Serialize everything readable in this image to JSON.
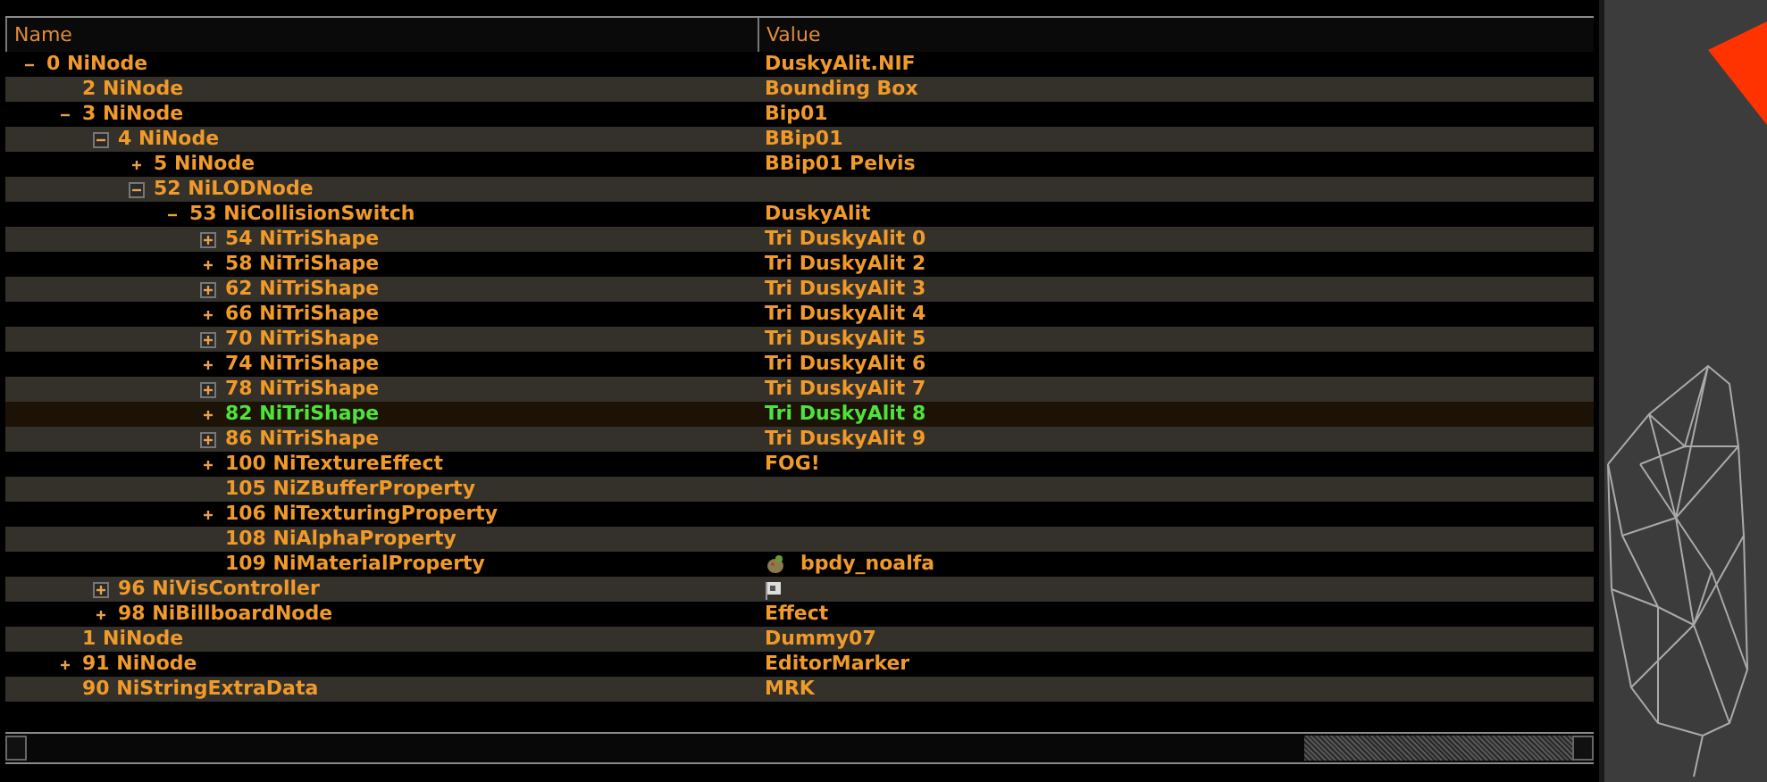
{
  "columns": [
    "Name",
    "Value"
  ],
  "tree": [
    {
      "name": "0 NiNode",
      "value": "DuskyAlit.NIF",
      "kind": "branch",
      "expanded": true,
      "boxed": false,
      "selected": false,
      "children": [
        {
          "name": "2 NiNode",
          "value": "Bounding Box",
          "kind": "leaf",
          "selected": false
        },
        {
          "name": "3 NiNode",
          "value": "Bip01",
          "kind": "branch",
          "expanded": true,
          "boxed": false,
          "selected": false,
          "children": [
            {
              "name": "4 NiNode",
              "value": "BBip01",
              "kind": "branch",
              "expanded": true,
              "boxed": true,
              "selected": false,
              "children": [
                {
                  "name": "5 NiNode",
                  "value": "BBip01 Pelvis",
                  "kind": "branch",
                  "expanded": false,
                  "boxed": false,
                  "selected": false
                },
                {
                  "name": "52 NiLODNode",
                  "kind": "branch",
                  "expanded": true,
                  "boxed": true,
                  "selected": false,
                  "children": [
                    {
                      "name": "53 NiCollisionSwitch",
                      "value": "DuskyAlit",
                      "kind": "branch",
                      "expanded": true,
                      "boxed": false,
                      "selected": false,
                      "children": [
                        {
                          "name": "54 NiTriShape",
                          "value": "Tri DuskyAlit 0",
                          "kind": "branch",
                          "expanded": false,
                          "boxed": true,
                          "selected": false
                        },
                        {
                          "name": "58 NiTriShape",
                          "value": "Tri DuskyAlit 2",
                          "kind": "branch",
                          "expanded": false,
                          "boxed": false,
                          "selected": false
                        },
                        {
                          "name": "62 NiTriShape",
                          "value": "Tri DuskyAlit 3",
                          "kind": "branch",
                          "expanded": false,
                          "boxed": true,
                          "selected": false
                        },
                        {
                          "name": "66 NiTriShape",
                          "value": "Tri DuskyAlit 4",
                          "kind": "branch",
                          "expanded": false,
                          "boxed": false,
                          "selected": false
                        },
                        {
                          "name": "70 NiTriShape",
                          "value": "Tri DuskyAlit 5",
                          "kind": "branch",
                          "expanded": false,
                          "boxed": true,
                          "selected": false
                        },
                        {
                          "name": "74 NiTriShape",
                          "value": "Tri DuskyAlit 6",
                          "kind": "branch",
                          "expanded": false,
                          "boxed": false,
                          "selected": false
                        },
                        {
                          "name": "78 NiTriShape",
                          "value": "Tri DuskyAlit 7",
                          "kind": "branch",
                          "expanded": false,
                          "boxed": true,
                          "selected": false
                        },
                        {
                          "name": "82 NiTriShape",
                          "value": "Tri DuskyAlit 8",
                          "kind": "branch",
                          "expanded": false,
                          "boxed": false,
                          "selected": true
                        },
                        {
                          "name": "86 NiTriShape",
                          "value": "Tri DuskyAlit 9",
                          "kind": "branch",
                          "expanded": false,
                          "boxed": true,
                          "selected": false
                        },
                        {
                          "name": "100 NiTextureEffect",
                          "value": "FOG!",
                          "kind": "branch",
                          "expanded": false,
                          "boxed": false,
                          "selected": false
                        },
                        {
                          "name": "105 NiZBufferProperty",
                          "kind": "leaf",
                          "selected": false
                        },
                        {
                          "name": "106 NiTexturingProperty",
                          "kind": "branch",
                          "expanded": false,
                          "boxed": false,
                          "selected": false
                        },
                        {
                          "name": "108 NiAlphaProperty",
                          "kind": "leaf",
                          "selected": false
                        },
                        {
                          "name": "109 NiMaterialProperty",
                          "value": "bpdy_noalfa",
                          "badge": {
                            "kind": "material"
                          },
                          "kind": "leaf",
                          "selected": false
                        }
                      ]
                    }
                  ]
                }
              ]
            },
            {
              "name": "96 NiVisController",
              "badge": {
                "kind": "controller"
              },
              "kind": "branch",
              "expanded": false,
              "boxed": true,
              "selected": false
            },
            {
              "name": "98 NiBillboardNode",
              "value": "Effect",
              "kind": "branch",
              "expanded": false,
              "boxed": false,
              "selected": false
            }
          ]
        },
        {
          "name": "1 NiNode",
          "value": "Dummy07",
          "kind": "leaf",
          "selected": false
        },
        {
          "name": "91 NiNode",
          "value": "EditorMarker",
          "kind": "branch",
          "expanded": false,
          "boxed": false,
          "selected": false
        },
        {
          "name": "90 NiStringExtraData",
          "value": "MRK",
          "kind": "leaf",
          "selected": false
        }
      ]
    }
  ]
}
